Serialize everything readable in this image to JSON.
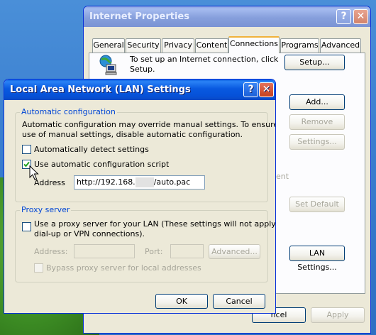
{
  "desktop": {
    "accent": "#3b7fd0"
  },
  "internet_properties": {
    "title": "Internet Properties",
    "help_glyph": "?",
    "close_glyph": "✕",
    "tabs": [
      {
        "label": "General"
      },
      {
        "label": "Security"
      },
      {
        "label": "Privacy"
      },
      {
        "label": "Content"
      },
      {
        "label": "Connections",
        "selected": true
      },
      {
        "label": "Programs"
      },
      {
        "label": "Advanced"
      }
    ],
    "setup_text_line1": "To set up an Internet connection, click",
    "setup_text_line2": "Setup.",
    "setup_button": "Setup...",
    "add_button": "Add...",
    "remove_button": "Remove",
    "settings_button": "Settings...",
    "partial_text": "ent",
    "set_default_button": "Set Default",
    "lan_settings_button": "LAN Settings...",
    "cancel_button_partial": "ncel",
    "apply_button": "Apply"
  },
  "lan_dialog": {
    "title": "Local Area Network (LAN) Settings",
    "help_glyph": "?",
    "close_glyph": "✕",
    "auto_config": {
      "group_label": "Automatic configuration",
      "description_line1": "Automatic configuration may override manual settings.  To ensure the",
      "description_line2": "use of manual settings, disable automatic configuration.",
      "auto_detect_label": "Automatically detect settings",
      "auto_detect_checked": false,
      "use_script_label": "Use automatic configuration script",
      "use_script_checked": true,
      "address_label": "Address",
      "address_prefix": "http://192.168.",
      "address_suffix": "/auto.pac"
    },
    "proxy": {
      "group_label": "Proxy server",
      "use_proxy_line1": "Use a proxy server for your LAN (These settings will not apply to",
      "use_proxy_line2": "dial-up or VPN connections).",
      "use_proxy_checked": false,
      "address_label": "Address:",
      "port_label": "Port:",
      "advanced_button": "Advanced...",
      "bypass_label": "Bypass proxy server for local addresses"
    },
    "ok_button": "OK",
    "cancel_button": "Cancel"
  }
}
